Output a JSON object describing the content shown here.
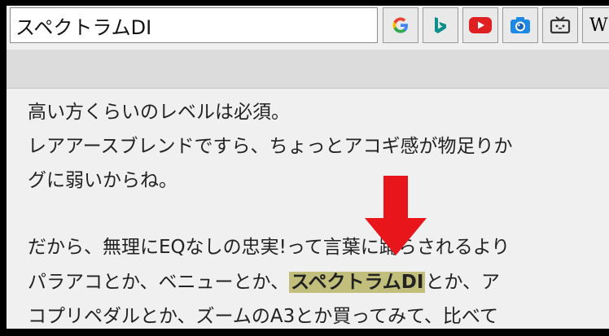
{
  "search": {
    "value": "スペクトラムDI",
    "placeholder": ""
  },
  "toolbar": {
    "buttons": [
      {
        "name": "google",
        "icon": "google-icon",
        "color": "#4285f4"
      },
      {
        "name": "bing",
        "icon": "bing-icon",
        "color": "#0a8f8a"
      },
      {
        "name": "youtube",
        "icon": "youtube-icon",
        "color": "#e02020"
      },
      {
        "name": "image-search",
        "icon": "camera-icon",
        "color": "#1e88e5"
      },
      {
        "name": "niconico",
        "icon": "tv-icon",
        "color": "#333333"
      },
      {
        "name": "wikipedia",
        "icon": "wikipedia-icon",
        "label": "W",
        "color": "#000000"
      }
    ]
  },
  "article": {
    "line1": "高い方くらいのレベルは必須。",
    "line2": "レアアースブレンドですら、ちょっとアコギ感が物足りか",
    "line3": "グに弱いからね。",
    "line4": "だから、無理にEQなしの忠実!って言葉に踊らされるより",
    "line5_before": "パラアコとか、ベニューとか、",
    "line5_highlight": "スペクトラムDI",
    "line5_after": "とか、ア",
    "line6": "コプリペダルとか、ズームのA3とか買ってみて、比べて"
  },
  "colors": {
    "highlight": "#c2bf7c",
    "arrow": "#e8161b",
    "background": "#f0f0f0"
  }
}
